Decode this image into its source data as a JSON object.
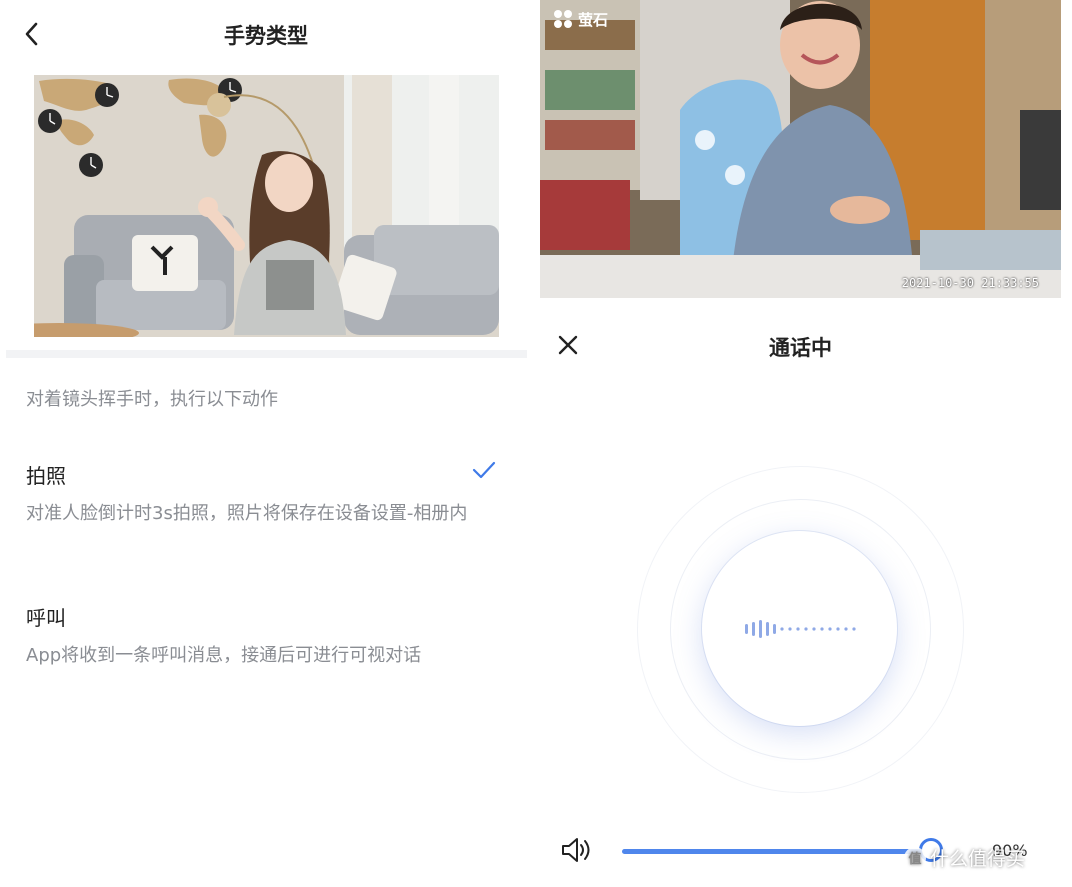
{
  "gesture_screen": {
    "title": "手势类型",
    "hint": "对着镜头挥手时，执行以下动作",
    "options": [
      {
        "title": "拍照",
        "description": "对准人脸倒计时3s拍照，照片将保存在设备设置-相册内",
        "selected": true
      },
      {
        "title": "呼叫",
        "description": "App将收到一条呼叫消息，接通后可进行可视对话",
        "selected": false
      }
    ]
  },
  "call_screen": {
    "camera": {
      "logo_text": "萤石",
      "timestamp": "2021-10-30 21:33:55"
    },
    "title": "通话中",
    "volume": {
      "percent_label": "90%",
      "level": 0.9
    }
  },
  "watermark": {
    "badge": "值",
    "text": "什么值得买"
  },
  "icons": {
    "back": "chevron-left-icon",
    "check": "checkmark-icon",
    "close": "close-icon",
    "volume": "speaker-icon",
    "wave": "voice-wave-icon"
  },
  "colors": {
    "accent": "#4f86ec",
    "check": "#3f7ae8",
    "muted_text": "#8a8d93",
    "divider": "#f2f3f5"
  }
}
